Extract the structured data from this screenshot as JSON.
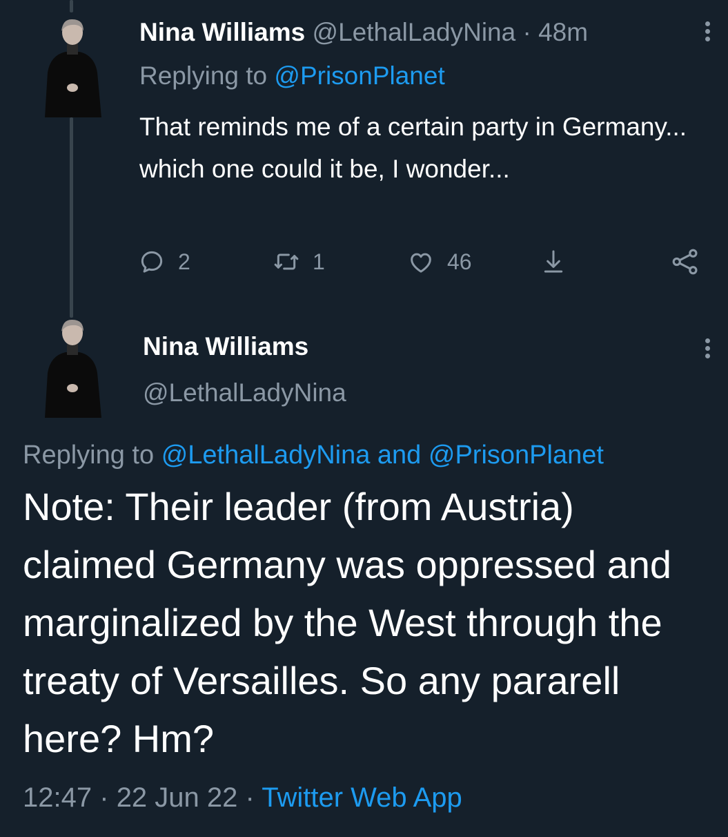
{
  "tweet1": {
    "display_name": "Nina Williams",
    "handle": "@LethalLadyNina",
    "time_separator": "·",
    "time": "48m",
    "replying_prefix": "Replying to",
    "replying_to": "@PrisonPlanet",
    "text": "That reminds me of a certain party in Germany... which one could it be, I wonder...",
    "stats": {
      "replies": "2",
      "retweets": "1",
      "likes": "46"
    }
  },
  "tweet2": {
    "display_name": "Nina Williams",
    "handle": "@LethalLadyNina",
    "replying_prefix": "Replying to",
    "replying_to": "@LethalLadyNina and @PrisonPlanet",
    "text": "Note: Their leader (from Austria) claimed Germany was oppressed and marginalized by the West through the treaty of Versailles. So any pararell here? Hm?",
    "time": "12:47",
    "separator": "·",
    "date": "22 Jun 22",
    "source": "Twitter Web App"
  },
  "colors": {
    "background": "#15202b",
    "text_primary": "#ffffff",
    "text_muted": "#8b98a5",
    "link": "#1d9bf0",
    "thread_line": "#38444d"
  },
  "icons": [
    "reply-icon",
    "retweet-icon",
    "like-icon",
    "share-icon",
    "share-network-icon",
    "more-options-icon"
  ]
}
